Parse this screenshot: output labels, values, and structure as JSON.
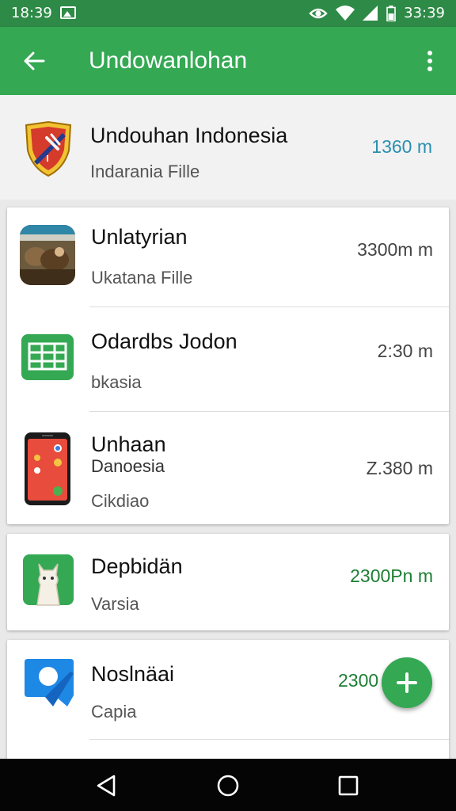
{
  "status_bar": {
    "time_left": "18:39",
    "time_right": "33:39",
    "icons": [
      "image-icon",
      "eye-icon",
      "wifi-icon",
      "signal-icon",
      "battery-icon"
    ]
  },
  "app_bar": {
    "title": "Undowanlohan",
    "back_icon": "arrow-left-icon",
    "menu_icon": "more-vertical-icon",
    "color": "#34a853"
  },
  "header_item": {
    "title": "Undouhan Indonesia",
    "subtitle": "Indarania Fille",
    "size": "1360 m",
    "size_color": "#2a8fb0",
    "icon": "shield-icon"
  },
  "card1": {
    "items": [
      {
        "title": "Unlatyrian",
        "subtitle": "Ukatana Fille",
        "size": "3300m m",
        "icon": "photo-thumbnail-icon"
      },
      {
        "title": "Odardbs Jodon",
        "subtitle": "bkasia",
        "size": "2:30 m",
        "icon": "spreadsheet-icon"
      },
      {
        "title": "Unhaan",
        "subtitle": "Danoesia",
        "subtitle2": "Cikdiao",
        "size": "Z.380 m",
        "icon": "phone-icon"
      }
    ]
  },
  "card2": {
    "title": "Depbidän",
    "subtitle": "Varsia",
    "size": "2300Pn m",
    "size_color": "#1e7e34",
    "icon": "llama-icon"
  },
  "card3": {
    "title": "Noslnäai",
    "subtitle": "Capia",
    "size": "2300",
    "size_color": "#1e7e34",
    "icon": "chat-bubble-icon"
  },
  "fab": {
    "icon": "plus-icon",
    "color": "#34a853"
  },
  "nav_bar": {
    "buttons": [
      "back-triangle-icon",
      "home-circle-icon",
      "recents-square-icon"
    ]
  }
}
